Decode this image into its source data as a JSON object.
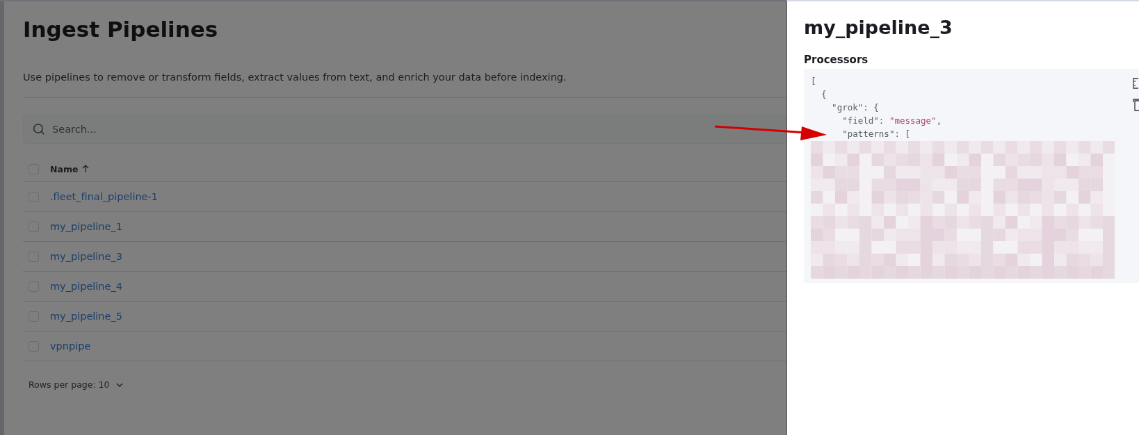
{
  "page": {
    "title": "Ingest Pipelines",
    "description": "Use pipelines to remove or transform fields, extract values from text, and enrich your data before indexing."
  },
  "search": {
    "placeholder": "Search..."
  },
  "table": {
    "header": {
      "label": "Name",
      "checked": false
    },
    "rows": [
      {
        "name": ".fleet_final_pipeline-1",
        "checked": false
      },
      {
        "name": "my_pipeline_1",
        "checked": false
      },
      {
        "name": "my_pipeline_3",
        "checked": false
      },
      {
        "name": "my_pipeline_4",
        "checked": false
      },
      {
        "name": "my_pipeline_5",
        "checked": false
      },
      {
        "name": "vpnpipe",
        "checked": false
      }
    ]
  },
  "pagination": {
    "rows_per_page": "Rows per page: 10"
  },
  "flyout": {
    "title": "my_pipeline_3",
    "section": "Processors",
    "code_lines": [
      {
        "text": "["
      },
      {
        "text": "  {"
      },
      {
        "text": "    \"grok\": {"
      },
      {
        "text": "      \"field\": ",
        "string": "\"message\"",
        "after": ","
      },
      {
        "text": "      \"patterns\": ["
      }
    ]
  }
}
